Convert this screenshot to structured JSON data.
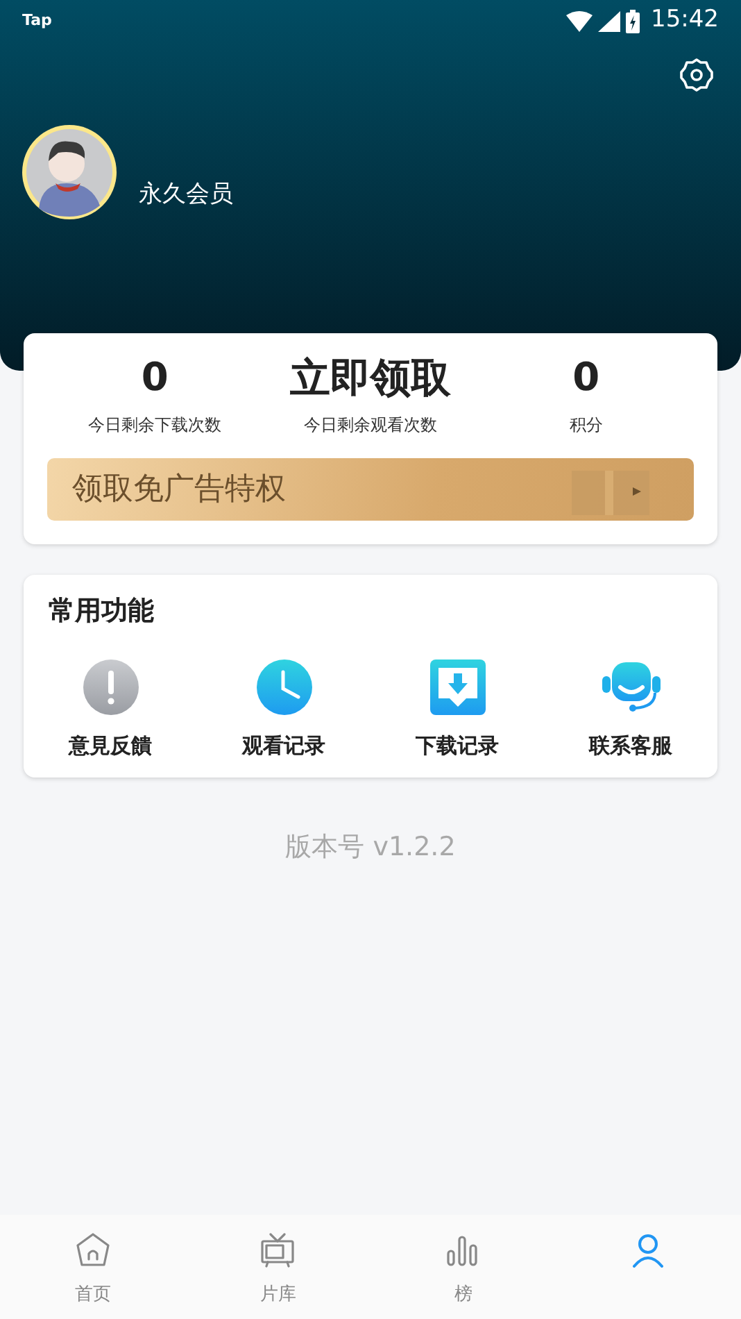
{
  "status_bar": {
    "carrier": "Tap",
    "time": "15:42"
  },
  "profile": {
    "name": "永久会员"
  },
  "stats": [
    {
      "value": "0",
      "label": "今日剩余下载次数",
      "kind": "number"
    },
    {
      "value": "立即领取",
      "label": "今日剩余观看次数",
      "kind": "action"
    },
    {
      "value": "0",
      "label": "积分",
      "kind": "number"
    }
  ],
  "banner": {
    "text": "领取免广告特权"
  },
  "functions": {
    "title": "常用功能",
    "items": [
      {
        "label": "意見反饋",
        "kind": "feedback"
      },
      {
        "label": "观看记录",
        "kind": "history"
      },
      {
        "label": "下载记录",
        "kind": "download"
      },
      {
        "label": "联系客服",
        "kind": "support"
      }
    ]
  },
  "version": "版本号 v1.2.2",
  "tabs": [
    {
      "label": "首页",
      "kind": "home",
      "selected": false
    },
    {
      "label": "片库",
      "kind": "tv",
      "selected": false
    },
    {
      "label": "榜",
      "kind": "chart",
      "selected": false
    },
    {
      "kind": "user",
      "selected": true
    }
  ]
}
